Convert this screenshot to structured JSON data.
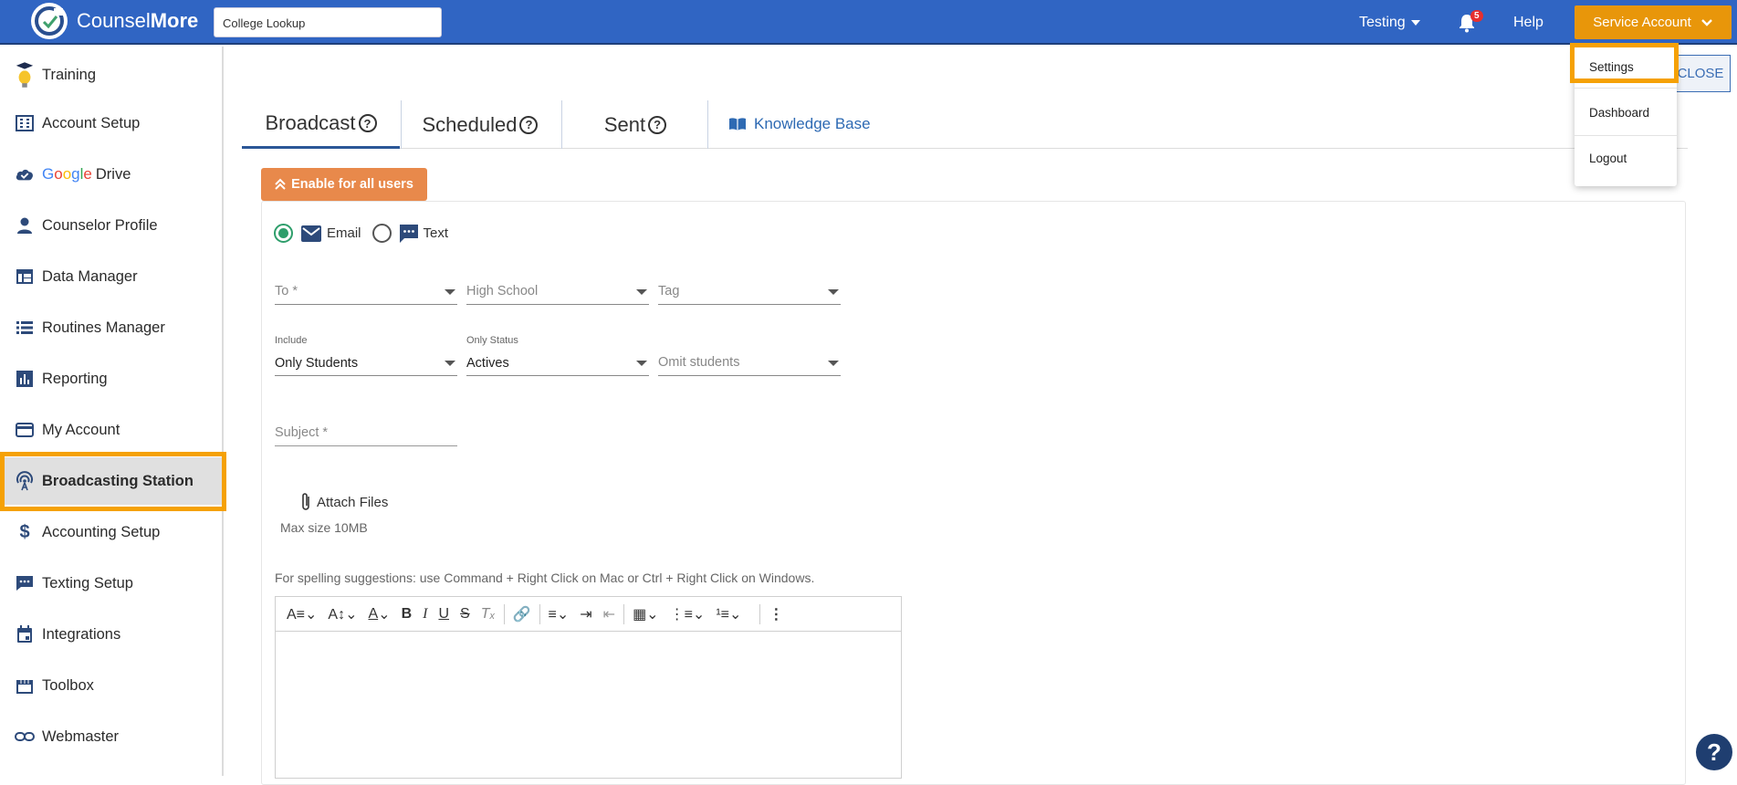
{
  "app": {
    "brand_light": "Counsel",
    "brand_bold": "More",
    "search_value": "College Lookup",
    "user_menu": "Testing",
    "notification_count": "5",
    "help": "Help",
    "account_button": "Service Account",
    "accent_color": "#3065c3",
    "highlight_color": "#f5a106"
  },
  "account_menu": {
    "items": [
      "Settings",
      "Dashboard",
      "Logout"
    ]
  },
  "sidebar": {
    "items": [
      {
        "label": "Training",
        "icon": "graduation-bulb-icon"
      },
      {
        "label": "Account Setup",
        "icon": "building-icon"
      },
      {
        "label_google": "Google",
        "label": "Drive",
        "icon": "cloud-check-icon"
      },
      {
        "label": "Counselor Profile",
        "icon": "person-icon"
      },
      {
        "label": "Data Manager",
        "icon": "table-icon"
      },
      {
        "label": "Routines Manager",
        "icon": "list-icon"
      },
      {
        "label": "Reporting",
        "icon": "bar-chart-icon"
      },
      {
        "label": "My Account",
        "icon": "credit-card-icon"
      },
      {
        "label": "Broadcasting Station",
        "icon": "broadcast-icon",
        "active": true
      },
      {
        "label": "Accounting Setup",
        "icon": "dollar-icon"
      },
      {
        "label": "Texting Setup",
        "icon": "chat-icon"
      },
      {
        "label": "Integrations",
        "icon": "calendar-icon"
      },
      {
        "label": "Toolbox",
        "icon": "store-icon"
      },
      {
        "label": "Webmaster",
        "icon": "link-icon"
      }
    ]
  },
  "main": {
    "close": "CLOSE",
    "tabs": [
      "Broadcast",
      "Scheduled",
      "Sent"
    ],
    "knowledge_base": "Knowledge Base",
    "enable_button": "Enable for all users",
    "radio": {
      "email": "Email",
      "text": "Text",
      "selected": "Email"
    },
    "fields": {
      "to": "To *",
      "high_school": "High School",
      "tag": "Tag",
      "include_label": "Include",
      "include_value": "Only Students",
      "status_label": "Only Status",
      "status_value": "Actives",
      "omit": "Omit students",
      "subject": "Subject *"
    },
    "attach": "Attach Files",
    "max_size": "Max size 10MB",
    "spelling": "For spelling suggestions: use Command + Right Click on Mac or Ctrl + Right Click on Windows."
  }
}
